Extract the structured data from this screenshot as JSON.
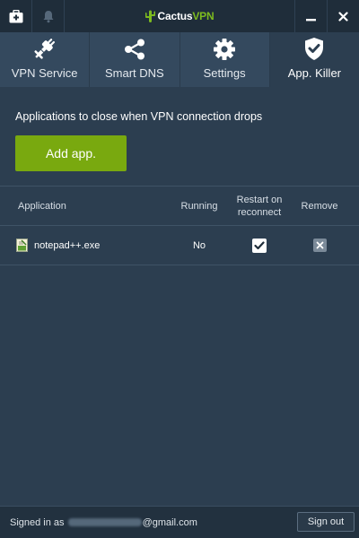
{
  "titlebar": {
    "brand_prefix": "Cactus",
    "brand_suffix": "VPN",
    "left_icons": [
      "toolbox-icon",
      "bell-icon"
    ],
    "right_icons": [
      "minimize-icon",
      "close-icon"
    ]
  },
  "nav": {
    "tabs": [
      {
        "label": "VPN Service",
        "icon": "plug-icon",
        "active": false
      },
      {
        "label": "Smart DNS",
        "icon": "share-icon",
        "active": false
      },
      {
        "label": "Settings",
        "icon": "gear-icon",
        "active": false
      },
      {
        "label": "App. Killer",
        "icon": "shield-check-icon",
        "active": true
      }
    ]
  },
  "main": {
    "headline": "Applications to close when VPN connection drops",
    "add_button_label": "Add app."
  },
  "table": {
    "columns": {
      "application": "Application",
      "running": "Running",
      "restart": "Restart on reconnect",
      "remove": "Remove"
    },
    "rows": [
      {
        "application": "notepad++.exe",
        "running": "No",
        "restart_on_reconnect": true,
        "icon": "notepad-icon"
      }
    ]
  },
  "footer": {
    "signed_in_prefix": "Signed in as",
    "email_domain": "@gmail.com",
    "sign_out_label": "Sign out"
  },
  "colors": {
    "background": "#2c3e50",
    "titlebar": "#1f2d3a",
    "nav": "#34495e",
    "accent_green": "#79a90f",
    "footer": "#22313f"
  }
}
